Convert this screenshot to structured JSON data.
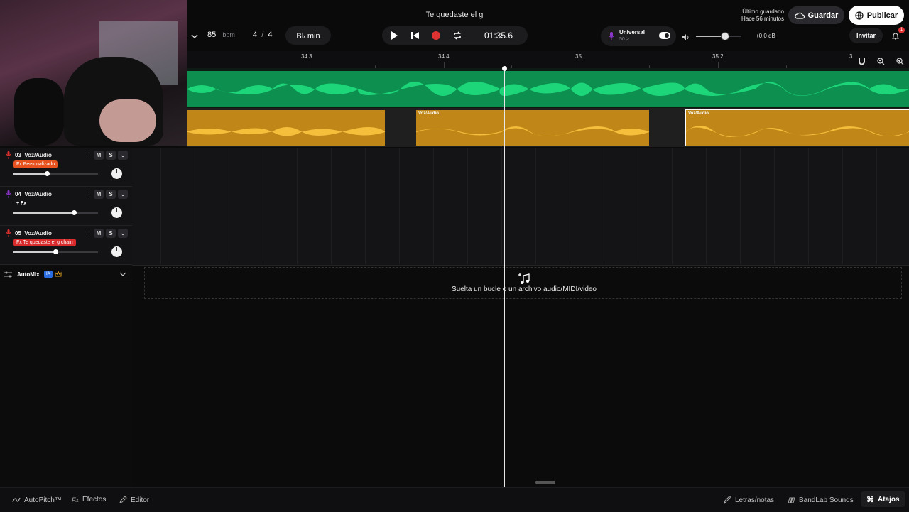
{
  "project": {
    "title": "Te quedaste el g"
  },
  "transport": {
    "bpm_value": "85",
    "bpm_unit": "bpm",
    "time_sig_num": "4",
    "time_sig_sep": "/",
    "time_sig_den": "4",
    "key": "B♭ min",
    "time": "01:35.6"
  },
  "preset": {
    "name": "Universal",
    "sub": "50 >"
  },
  "volume": {
    "db": "+0.0 dB",
    "level": 0.64
  },
  "save": {
    "last_saved_label": "Último guardado",
    "last_saved_time": "Hace 56 minutos",
    "save_label": "Guardar",
    "publish_label": "Publicar"
  },
  "invite": {
    "label": "Invitar",
    "notif_count": "1"
  },
  "ruler": {
    "marks": [
      "34.3",
      "34.4",
      "35",
      "35.2",
      "3"
    ]
  },
  "clips": {
    "label": "Voz/Audio"
  },
  "tracks": [
    {
      "num": "03",
      "name": "Voz/Audio",
      "fx": "Fx Personalizado",
      "fx_color": "#e8521f",
      "mic_color": "#e0312f",
      "volume": 0.4
    },
    {
      "num": "04",
      "name": "Voz/Audio",
      "fx": "+ Fx",
      "fx_color": "transparent",
      "mic_color": "#8b34c9",
      "volume": 0.72
    },
    {
      "num": "05",
      "name": "Voz/Audio",
      "fx": "Fx Te quedaste el g chain",
      "fx_color": "#d92b2b",
      "mic_color": "#e0312f",
      "volume": 0.5
    }
  ],
  "mute_label": "M",
  "solo_label": "S",
  "automix": {
    "label": "AutoMix",
    "badge": "IA"
  },
  "dropzone": {
    "text": "Suelta un bucle o un archivo audio/MIDI/video"
  },
  "bottom": {
    "autopitch": "AutoPitch™",
    "effects": "Efectos",
    "editor": "Editor",
    "lyrics": "Letras/notas",
    "sounds": "BandLab Sounds",
    "shortcuts": "Atajos"
  },
  "colors": {
    "green_clip": "#14b866",
    "yellow_clip": "#e3a021",
    "accent_red": "#e03232"
  }
}
